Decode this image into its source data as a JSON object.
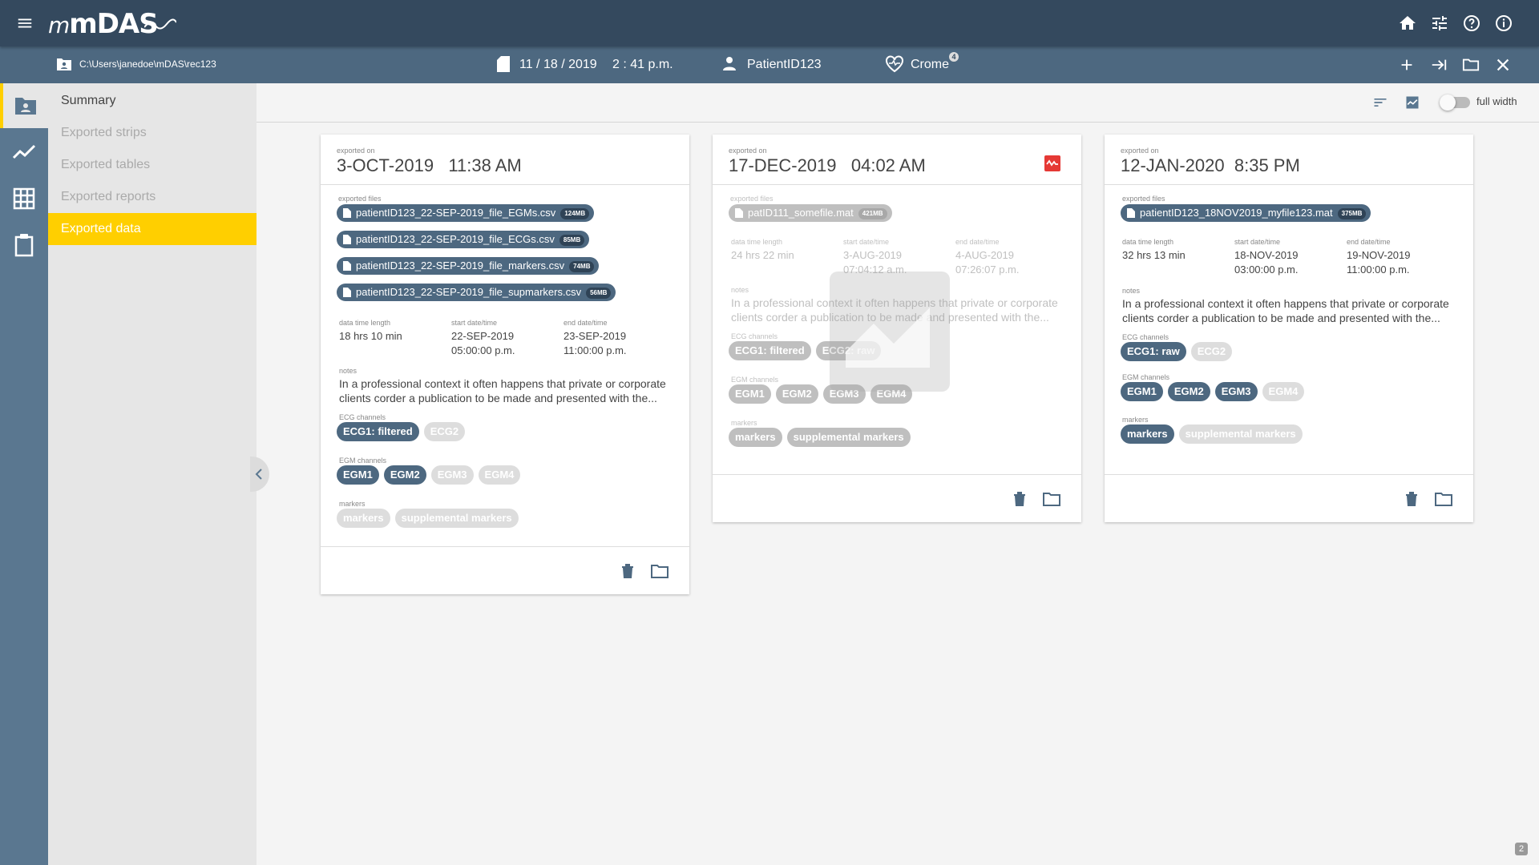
{
  "app": {
    "name": "mDAS"
  },
  "infobar": {
    "path": "C:\\Users\\janedoe\\mDAS\\rec123",
    "date": "11 / 18 / 2019",
    "time": "2 : 41 p.m.",
    "patient": "PatientID123",
    "device": "Crome",
    "device_badge": "4"
  },
  "sidebar": {
    "items": [
      {
        "label": "Summary",
        "state": "title"
      },
      {
        "label": "Exported strips",
        "state": "inactive"
      },
      {
        "label": "Exported tables",
        "state": "inactive"
      },
      {
        "label": "Exported reports",
        "state": "inactive"
      },
      {
        "label": "Exported data",
        "state": "active"
      }
    ]
  },
  "rail": {
    "icons": [
      "patient-folder-icon",
      "chart-line-icon",
      "grid-icon",
      "clipboard-icon"
    ]
  },
  "toolbar": {
    "full_width_label": "full width",
    "full_width_on": false
  },
  "labels": {
    "exported_on": "exported on",
    "exported_files": "exported files",
    "data_time_length": "data time length",
    "start": "start date/time",
    "end": "end date/time",
    "notes": "notes",
    "ecg": "ECG channels",
    "egm": "EGM channels",
    "markers": "markers"
  },
  "cards": [
    {
      "date": "3-OCT-2019",
      "time": "11:38 AM",
      "dimmed": false,
      "files": [
        {
          "name": "patientID123_22-SEP-2019_file_EGMs.csv",
          "size": "124MB"
        },
        {
          "name": "patientID123_22-SEP-2019_file_ECGs.csv",
          "size": "85MB"
        },
        {
          "name": "patientID123_22-SEP-2019_file_markers.csv",
          "size": "74MB"
        },
        {
          "name": "patientID123_22-SEP-2019_file_supmarkers.csv",
          "size": "56MB"
        }
      ],
      "length": "18 hrs 10 min",
      "start_date": "22-SEP-2019",
      "start_time": "05:00:00 p.m.",
      "end_date": "23-SEP-2019",
      "end_time": "11:00:00 p.m.",
      "notes": "In a professional context it often happens that private or corporate clients corder a publication to be made and presented with the...",
      "ecg": [
        {
          "label": "ECG1: filtered",
          "on": true
        },
        {
          "label": "ECG2",
          "on": false
        }
      ],
      "egm": [
        {
          "label": "EGM1",
          "on": true
        },
        {
          "label": "EGM2",
          "on": true
        },
        {
          "label": "EGM3",
          "on": false
        },
        {
          "label": "EGM4",
          "on": false
        }
      ],
      "markers": [
        {
          "label": "markers",
          "on": false
        },
        {
          "label": "supplemental markers",
          "on": false
        }
      ]
    },
    {
      "date": "17-DEC-2019",
      "time": "04:02 AM",
      "dimmed": true,
      "files": [
        {
          "name": "patID111_somefile.mat",
          "size": "421MB"
        }
      ],
      "length": "24 hrs 22 min",
      "start_date": "3-AUG-2019",
      "start_time": "07:04:12 a.m.",
      "end_date": "4-AUG-2019",
      "end_time": "07:26:07 p.m.",
      "notes": "In a professional context it often happens that private or corporate clients corder a publication to be made and presented with the...",
      "ecg": [
        {
          "label": "ECG1: filtered",
          "on": true
        },
        {
          "label": "ECG2: raw",
          "on": true
        }
      ],
      "egm": [
        {
          "label": "EGM1",
          "on": true
        },
        {
          "label": "EGM2",
          "on": true
        },
        {
          "label": "EGM3",
          "on": true
        },
        {
          "label": "EGM4",
          "on": true
        }
      ],
      "markers": [
        {
          "label": "markers",
          "on": true
        },
        {
          "label": "supplemental markers",
          "on": true
        }
      ]
    },
    {
      "date": "12-JAN-2020",
      "time": "8:35 PM",
      "dimmed": false,
      "files": [
        {
          "name": "patientID123_18NOV2019_myfile123.mat",
          "size": "375MB"
        }
      ],
      "length": "32 hrs 13 min",
      "start_date": "18-NOV-2019",
      "start_time": "03:00:00 p.m.",
      "end_date": "19-NOV-2019",
      "end_time": "11:00:00 p.m.",
      "notes": "In a professional context it often happens that private or corporate clients corder a publication to be made and presented with the...",
      "ecg": [
        {
          "label": "ECG1: raw",
          "on": true
        },
        {
          "label": "ECG2",
          "on": false
        }
      ],
      "egm": [
        {
          "label": "EGM1",
          "on": true
        },
        {
          "label": "EGM2",
          "on": true
        },
        {
          "label": "EGM3",
          "on": true
        },
        {
          "label": "EGM4",
          "on": false
        }
      ],
      "markers": [
        {
          "label": "markers",
          "on": true
        },
        {
          "label": "supplemental markers",
          "on": false
        }
      ]
    }
  ],
  "corner_badge": "2",
  "colors": {
    "appbar": "#34495e",
    "infobar": "#4d6880",
    "rail": "#5a7790",
    "accent": "#ffcf00",
    "chip": "#4d6880",
    "alert": "#e53935"
  }
}
